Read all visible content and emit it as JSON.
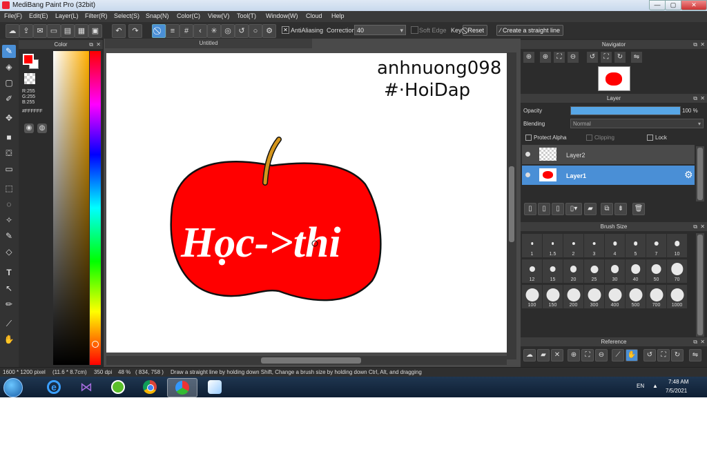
{
  "window": {
    "title": "MediBang Paint Pro (32bit)",
    "controls": [
      "—",
      "▢",
      "✕"
    ]
  },
  "menu": [
    "File(F)",
    "Edit(E)",
    "Layer(L)",
    "Filter(R)",
    "Select(S)",
    "Snap(N)",
    "Color(C)",
    "View(V)",
    "Tool(T)",
    "Window(W)",
    "Cloud",
    "Help"
  ],
  "toolbar": {
    "antialiasing_label": "AntiAliasing",
    "antialiasing_checked": true,
    "correction_label": "Correction",
    "correction_value": "40",
    "soft_edge_label": "Soft Edge",
    "key_label": "Key",
    "reset_label": "Reset",
    "straight_line_label": "Create a straight line"
  },
  "color_panel": {
    "title": "Color",
    "r": "R:255",
    "g": "G:255",
    "b": "B:255",
    "hex": "#FFFFFF",
    "primary": "#ff0000",
    "secondary": "#ffffff"
  },
  "document": {
    "tab": "Untitled",
    "watermark_line1": "anhnuong098",
    "watermark_line2": "#·HoiDap",
    "apple_text": "Học->thi",
    "apple_color": "#ff0000"
  },
  "navigator": {
    "title": "Navigator"
  },
  "layer_panel": {
    "title": "Layer",
    "opacity_label": "Opacity",
    "opacity_value": "100 %",
    "opacity_fraction": 1.0,
    "blending_label": "Blending",
    "blending_value": "Normal",
    "protect_alpha": "Protect Alpha",
    "clipping": "Clipping",
    "lock": "Lock",
    "layers": [
      {
        "name": "Layer2",
        "selected": false
      },
      {
        "name": "Layer1",
        "selected": true
      }
    ]
  },
  "brush_size": {
    "title": "Brush Size",
    "sizes": [
      "1",
      "1.5",
      "2",
      "3",
      "4",
      "5",
      "7",
      "10",
      "12",
      "15",
      "20",
      "25",
      "30",
      "40",
      "50",
      "70",
      "100",
      "150",
      "200",
      "300",
      "400",
      "500",
      "700",
      "1000"
    ]
  },
  "reference": {
    "title": "Reference"
  },
  "status": {
    "dimensions": "1600 * 1200 pixel",
    "physical": "(11.6 * 8.7cm)",
    "dpi": "350 dpi",
    "zoom": "48 %",
    "coords": "( 834, 758 )",
    "hint": "Draw a straight line by holding down Shift, Change a brush size by holding down Ctrl, Alt, and dragging"
  },
  "taskbar": {
    "lang": "EN",
    "time": "7:48 AM",
    "date": "7/5/2021"
  }
}
